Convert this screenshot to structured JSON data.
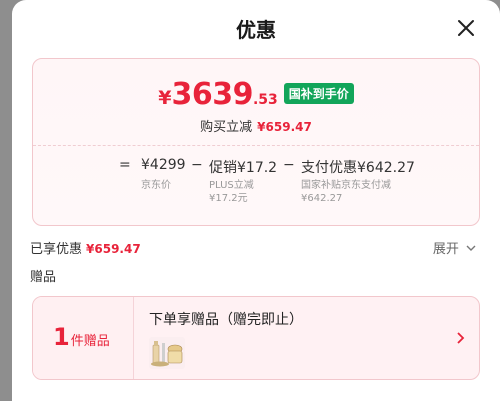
{
  "header": {
    "title": "优惠",
    "close_icon": "close-icon"
  },
  "price": {
    "yen": "¥",
    "main": "3639",
    "decimal": ".53",
    "badge": "国补到手价",
    "discount_label": "购买立减",
    "discount_amount": "¥659.47"
  },
  "formula": {
    "equals": "=",
    "base_value": "¥4299",
    "base_label": "京东价",
    "minus1": "−",
    "promo_value": "促销¥17.2",
    "promo_label_line1": "PLUS立减",
    "promo_label_line2": "¥17.2元",
    "minus2": "−",
    "pay_value": "支付优惠¥642.27",
    "pay_label_line1": "国家补贴京东支付减",
    "pay_label_line2": "¥642.27"
  },
  "summary": {
    "enjoyed_label": "已享优惠",
    "enjoyed_amount": "¥659.47",
    "expand_label": "展开"
  },
  "gifts": {
    "section_label": "赠品",
    "count": "1",
    "count_label": "件赠品",
    "title": "下单享赠品（赠完即止）",
    "thumb_icon": "gift-items-thumbnail"
  },
  "colors": {
    "accent_red": "#e8233a",
    "badge_green": "#12a55a",
    "card_border": "#f2c7cc"
  }
}
